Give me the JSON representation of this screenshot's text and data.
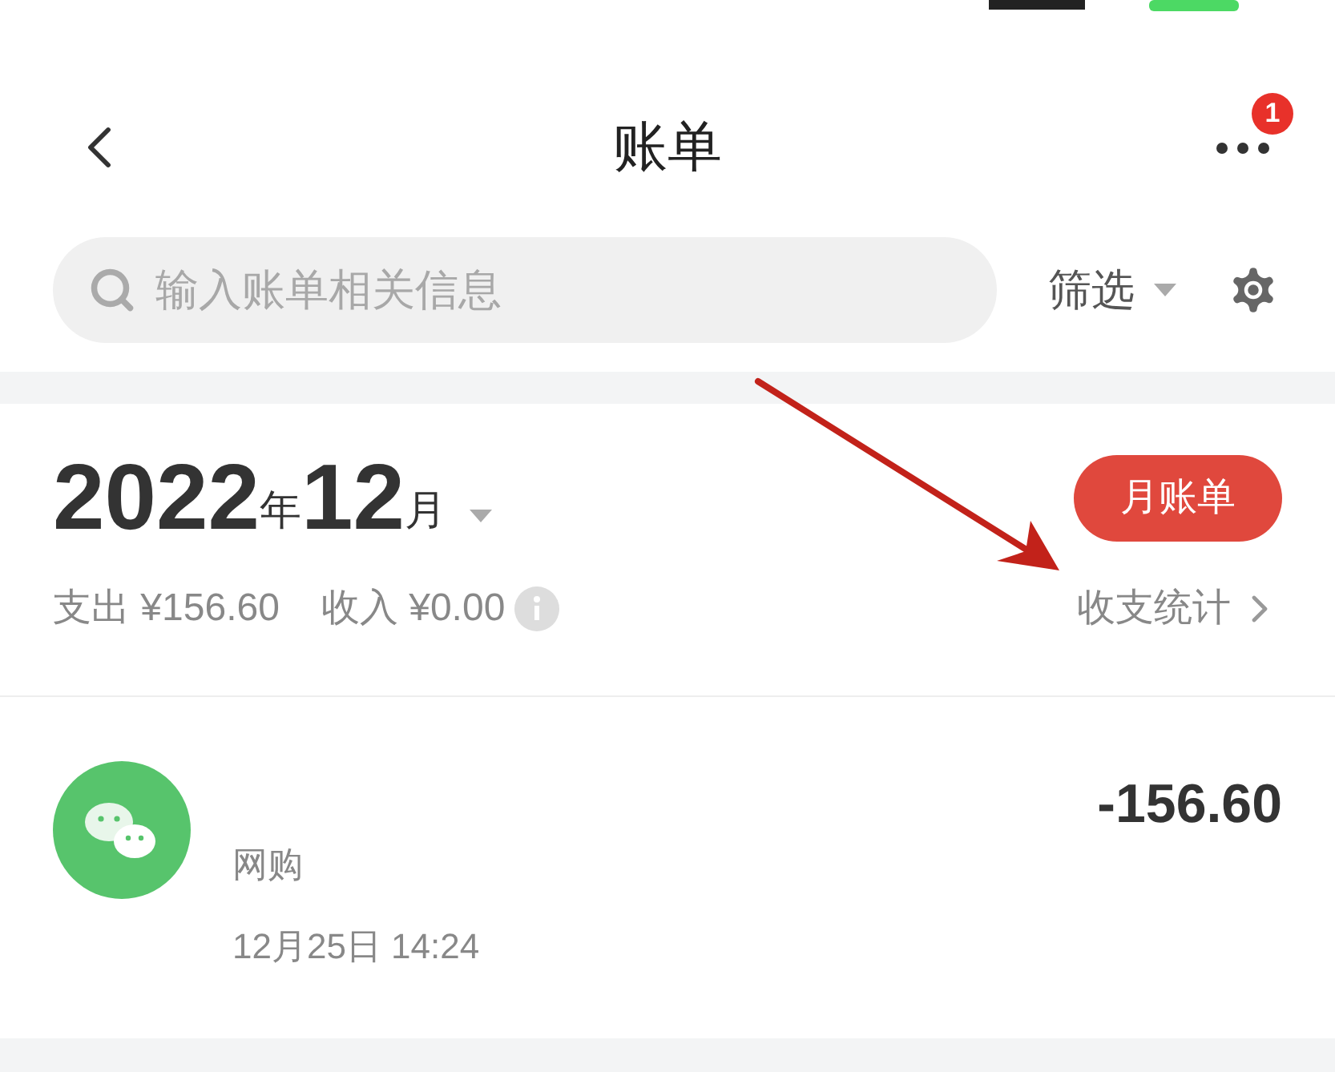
{
  "header": {
    "title": "账单",
    "badge": "1"
  },
  "search": {
    "placeholder": "输入账单相关信息"
  },
  "filter": {
    "label": "筛选"
  },
  "month": {
    "year": "2022",
    "year_unit": "年",
    "month": "12",
    "month_unit": "月",
    "button": "月账单",
    "expense_label": "支出",
    "expense": "¥156.60",
    "income_label": "收入",
    "income": "¥0.00",
    "stats_link": "收支统计"
  },
  "transactions": [
    {
      "amount": "-156.60",
      "category": "网购",
      "time": "12月25日 14:24"
    }
  ]
}
